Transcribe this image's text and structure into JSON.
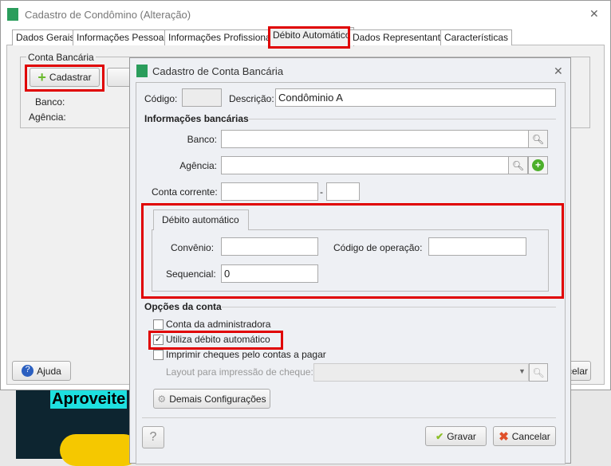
{
  "main_window": {
    "title": "Cadastro de Condômino (Alteração)",
    "tabs": [
      "Dados Gerais",
      "Informações Pessoais",
      "Informações Profissionais",
      "Débito Automático",
      "Dados Representante",
      "Características"
    ],
    "active_tab": "Débito Automático",
    "group_title": "Conta Bancária",
    "cadastrar_label": "Cadastrar",
    "banco_label": "Banco:",
    "agencia_label": "Agência:",
    "ajuda_label": "Ajuda",
    "cancelar_partial": "celar"
  },
  "ad": {
    "text": "Aproveite"
  },
  "dialog": {
    "title": "Cadastro de Conta Bancária",
    "codigo_label": "Código:",
    "codigo_value": "",
    "descricao_label": "Descrição:",
    "descricao_value": "Condôminio A",
    "bank_section": "Informações bancárias",
    "banco_label": "Banco:",
    "banco_value": "",
    "agencia_label": "Agência:",
    "agencia_value": "",
    "conta_label": "Conta corrente:",
    "conta_value": "",
    "conta_sep": "-",
    "conta_digit": "",
    "debit_tab": "Débito automático",
    "convenio_label": "Convênio:",
    "convenio_value": "",
    "codop_label": "Código de operação:",
    "codop_value": "",
    "sequencial_label": "Sequencial:",
    "sequencial_value": "0",
    "options_section": "Opções da conta",
    "options": [
      {
        "label": "Conta da administradora",
        "checked": false
      },
      {
        "label": "Utiliza débito automático",
        "checked": true
      },
      {
        "label": "Imprimir cheques pelo contas a pagar",
        "checked": false
      }
    ],
    "layout_label": "Layout para impressão de cheque:",
    "layout_value": "",
    "demais_label": "Demais Configurações",
    "help_label": "?",
    "gravar_label": "Gravar",
    "cancelar_label": "Cancelar"
  }
}
